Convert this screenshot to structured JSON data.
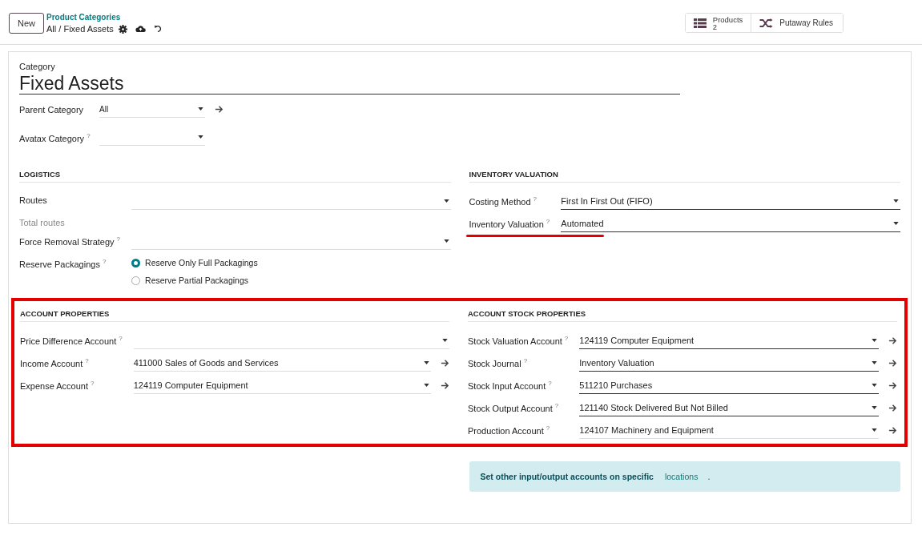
{
  "control_panel": {
    "new_button": "New",
    "breadcrumb": "Product Categories",
    "record_title": "All / Fixed Assets",
    "smart_buttons": [
      {
        "kind": "count",
        "label": "Products",
        "count": "2"
      },
      {
        "kind": "action",
        "label": "Putaway Rules"
      }
    ]
  },
  "form": {
    "category_label": "Category",
    "name": "Fixed Assets",
    "top_fields": [
      {
        "label": "Parent Category",
        "value": "All",
        "link": true
      },
      {
        "label": "Avatax Category",
        "help": "?",
        "link": false
      }
    ],
    "section_rows": [
      {
        "annotated": false,
        "columns": [
          {
            "title": "LOGISTICS",
            "fields": [
              {
                "kind": "select",
                "label": "Routes",
                "link": false,
                "emphasized": false,
                "underlined": false
              },
              {
                "kind": "note",
                "label": "Total routes"
              },
              {
                "kind": "select",
                "label": "Force Removal Strategy",
                "help": "?",
                "link": false,
                "emphasized": false,
                "underlined": false
              },
              {
                "kind": "radio",
                "label": "Reserve Packagings",
                "help": "?",
                "options": [
                  {
                    "label": "Reserve Only Full Packagings",
                    "selected": true
                  },
                  {
                    "label": "Reserve Partial Packagings",
                    "selected": false
                  }
                ]
              }
            ]
          },
          {
            "title": "INVENTORY VALUATION",
            "fields": [
              {
                "kind": "select",
                "label": "Costing Method",
                "value": "First In First Out (FIFO)",
                "help": "?",
                "link": false,
                "emphasized": true,
                "underlined": false
              },
              {
                "kind": "select",
                "label": "Inventory Valuation",
                "value": "Automated",
                "help": "?",
                "link": false,
                "emphasized": true,
                "underlined": true
              }
            ]
          }
        ]
      },
      {
        "annotated": true,
        "columns": [
          {
            "title": "ACCOUNT PROPERTIES",
            "fields": [
              {
                "kind": "select",
                "label": "Price Difference Account",
                "help": "?",
                "link": false,
                "emphasized": false,
                "underlined": false
              },
              {
                "kind": "select",
                "label": "Income Account",
                "value": "411000 Sales of Goods and Services",
                "help": "?",
                "link": true,
                "emphasized": false,
                "underlined": false
              },
              {
                "kind": "select",
                "label": "Expense Account",
                "value": "124119 Computer Equipment",
                "help": "?",
                "link": true,
                "emphasized": false,
                "underlined": false
              }
            ]
          },
          {
            "title": "ACCOUNT STOCK PROPERTIES",
            "fields": [
              {
                "kind": "select",
                "label": "Stock Valuation Account",
                "value": "124119 Computer Equipment",
                "help": "?",
                "link": true,
                "emphasized": true,
                "underlined": false
              },
              {
                "kind": "select",
                "label": "Stock Journal",
                "value": "Inventory Valuation",
                "help": "?",
                "link": true,
                "emphasized": true,
                "underlined": false
              },
              {
                "kind": "select",
                "label": "Stock Input Account",
                "value": "511210 Purchases",
                "help": "?",
                "link": true,
                "emphasized": true,
                "underlined": false
              },
              {
                "kind": "select",
                "label": "Stock Output Account",
                "value": "121140 Stock Delivered But Not Billed",
                "help": "?",
                "link": true,
                "emphasized": true,
                "underlined": false
              },
              {
                "kind": "select",
                "label": "Production Account",
                "value": "124107 Machinery and Equipment",
                "help": "?",
                "link": true,
                "emphasized": false,
                "underlined": false
              }
            ]
          }
        ]
      }
    ],
    "notice": {
      "text": "Set other input/output accounts on specific",
      "link": "locations",
      "end": "."
    }
  }
}
